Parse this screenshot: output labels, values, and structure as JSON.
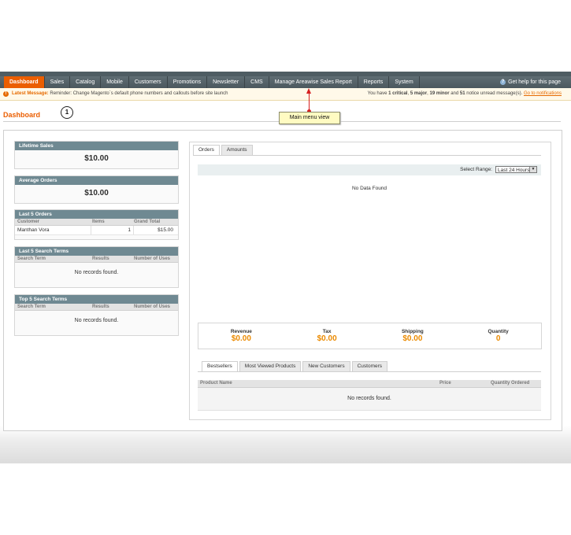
{
  "nav": {
    "items": [
      "Dashboard",
      "Sales",
      "Catalog",
      "Mobile",
      "Customers",
      "Promotions",
      "Newsletter",
      "CMS",
      "Manage Areawise Sales Report",
      "Reports",
      "System"
    ],
    "help": "Get help for this page"
  },
  "notice": {
    "label": "Latest Message:",
    "text": "Reminder: Change Magento`s default phone numbers and callouts before site launch",
    "summary_prefix": "You have",
    "critical": "1 critical",
    "major": "5 major",
    "minor": "19 minor",
    "and": "and",
    "notice_count": "51",
    "summary_suffix": "notice unread message(s).",
    "link": "Go to notifications"
  },
  "page": {
    "title": "Dashboard"
  },
  "annotation": {
    "number": "1",
    "callout": "Main menu view"
  },
  "lifetime_sales": {
    "title": "Lifetime Sales",
    "value": "$10.00"
  },
  "average_orders": {
    "title": "Average Orders",
    "value": "$10.00"
  },
  "last_orders": {
    "title": "Last 5 Orders",
    "columns": [
      "Customer",
      "Items",
      "Grand Total"
    ],
    "rows": [
      {
        "customer": "Manthan Vora",
        "items": "1",
        "total": "$15.00"
      }
    ]
  },
  "last_search": {
    "title": "Last 5 Search Terms",
    "columns": [
      "Search Term",
      "Results",
      "Number of Uses"
    ],
    "empty": "No records found."
  },
  "top_search": {
    "title": "Top 5 Search Terms",
    "columns": [
      "Search Term",
      "Results",
      "Number of Uses"
    ],
    "empty": "No records found."
  },
  "chart_tabs": [
    "Orders",
    "Amounts"
  ],
  "range": {
    "label": "Select Range:",
    "value": "Last 24 Hours"
  },
  "chart_empty": "No Data Found",
  "totals": [
    {
      "label": "Revenue",
      "value": "$0.00"
    },
    {
      "label": "Tax",
      "value": "$0.00"
    },
    {
      "label": "Shipping",
      "value": "$0.00"
    },
    {
      "label": "Quantity",
      "value": "0"
    }
  ],
  "bottom_tabs": [
    "Bestsellers",
    "Most Viewed Products",
    "New Customers",
    "Customers"
  ],
  "bestsellers": {
    "columns": [
      "Product Name",
      "Price",
      "Quantity Ordered"
    ],
    "empty": "No records found."
  },
  "colors": {
    "accent": "#eb5e00",
    "nav": "#56646a",
    "box_head": "#6f8992",
    "totals": "#eb8a00",
    "arrow": "#d62020"
  }
}
